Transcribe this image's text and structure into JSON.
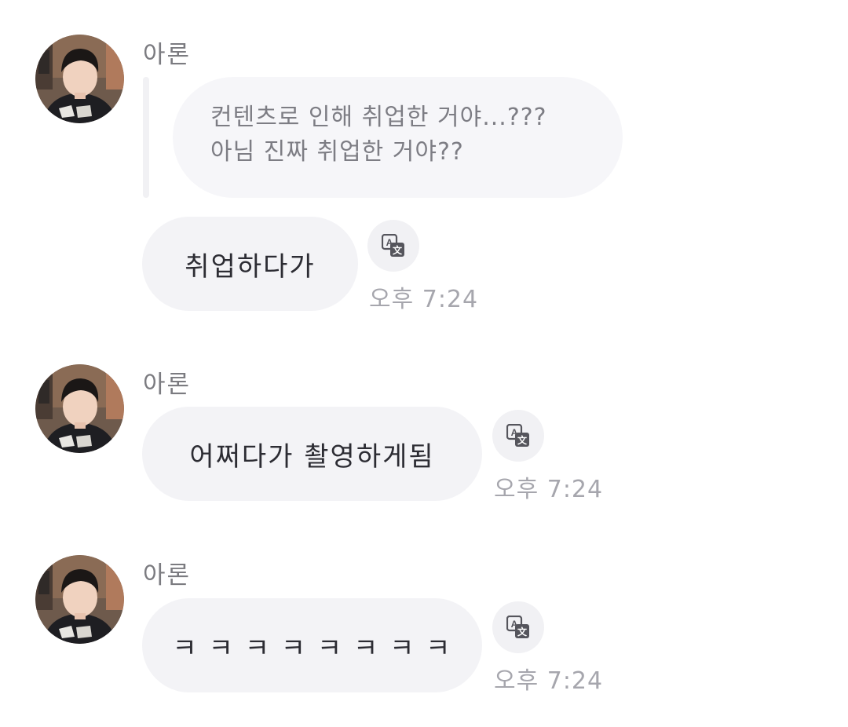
{
  "messages": [
    {
      "sender": "아론",
      "reply_quote": [
        "컨텐츠로 인해 취업한 거야...???",
        "아님 진짜 취업한 거야??"
      ],
      "text": "취업하다가",
      "time": "오후 7:24"
    },
    {
      "sender": "아론",
      "text": "어쩌다가 촬영하게됨",
      "time": "오후 7:24"
    },
    {
      "sender": "아론",
      "text": "ㅋ ㅋ ㅋ ㅋ ㅋ ㅋ ㅋ ㅋ",
      "time": "오후 7:24"
    }
  ],
  "icons": {
    "avatar": "profile-photo",
    "translate": "translate-icon"
  },
  "colors": {
    "bubble": "#f3f3f6",
    "quote_bubble": "#f6f6f9",
    "time_text": "#a6a6ad",
    "sender_text": "#7b7b80"
  }
}
